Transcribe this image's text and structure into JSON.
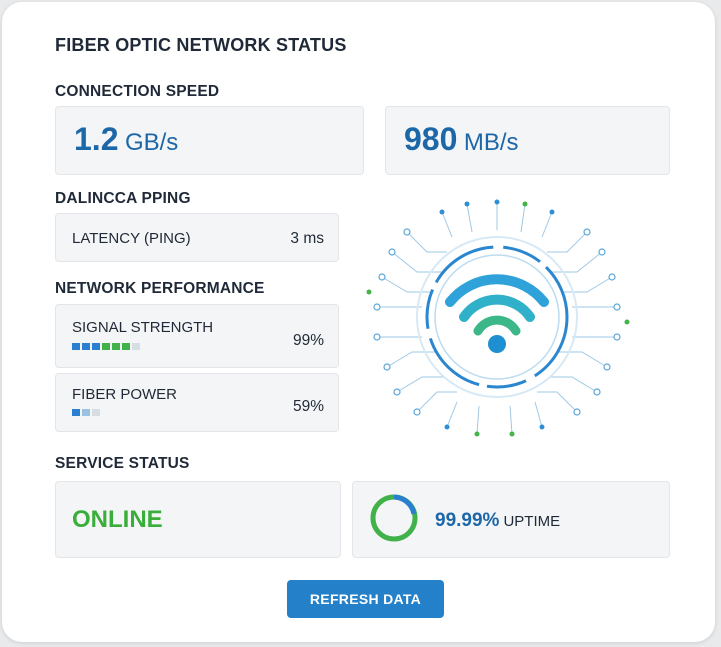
{
  "title": "FIBER OPTIC NETWORK STATUS",
  "connection_speed": {
    "heading": "CONNECTION SPEED",
    "download": {
      "value": "1.2",
      "unit": "GB/s",
      "display": "1.2 GB/s"
    },
    "upload": {
      "value": "980",
      "unit": "MB/s"
    }
  },
  "ping": {
    "heading": "DALINCCA PPING",
    "label": "LATENCY (PING)",
    "value": "3 ms"
  },
  "performance": {
    "heading": "NETWORK PERFORMANCE",
    "signal": {
      "label": "SIGNAL STRENGTH",
      "value": "99%",
      "level": 0.99
    },
    "fiber": {
      "label": "FIBER POWER",
      "value": "59%",
      "level": 0.59
    }
  },
  "service": {
    "heading": "SERVICE STATUS",
    "status": "ONLINE",
    "uptime_value": "99.99%",
    "uptime_label": "UPTIME"
  },
  "refresh_label": "REFRESH DATA",
  "graphic_icon": "wifi-circuit-icon",
  "colors": {
    "accent_blue": "#1c67a8",
    "button_blue": "#2480c9",
    "online_green": "#3aae3a",
    "bar_blue": "#2b7fd0",
    "bar_green": "#41b14a",
    "bar_empty": "#d6dde3"
  }
}
